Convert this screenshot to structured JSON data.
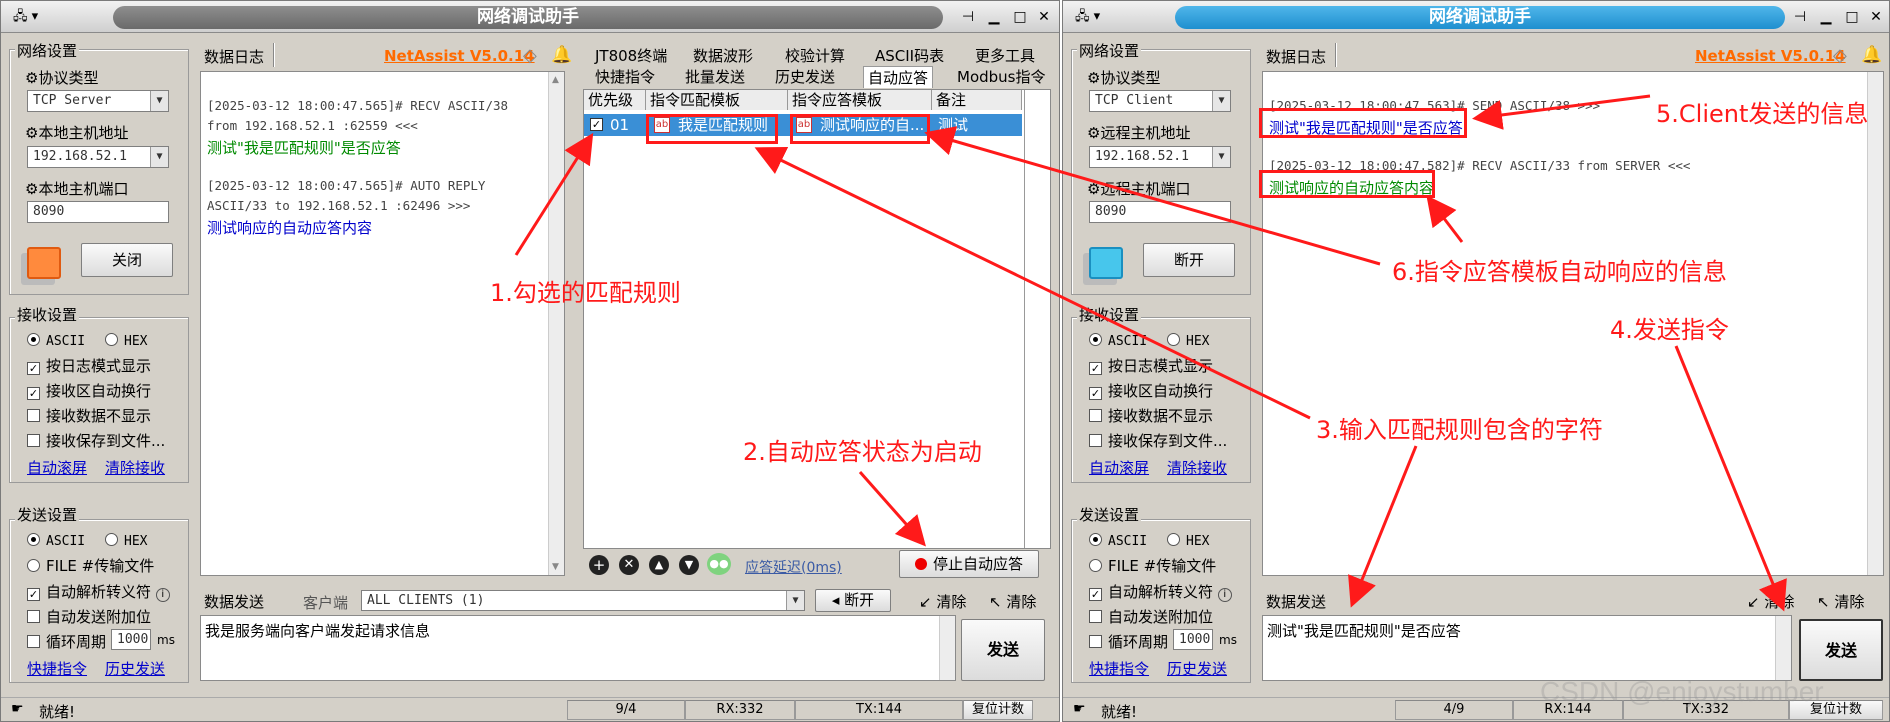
{
  "left": {
    "title": "网络调试助手",
    "brand": "NetAssist V5.0.14",
    "net_group": "网络设置",
    "protocol_label": "协议类型",
    "protocol_value": "TCP Server",
    "host_label": "本地主机地址",
    "host_value": "192.168.52.1",
    "port_label": "本地主机端口",
    "port_value": "8090",
    "connect_btn": "关闭",
    "log_tab": "数据日志",
    "recv_group": "接收设置",
    "recv_ascii": "ASCII",
    "recv_hex": "HEX",
    "recv_opts": [
      "按日志模式显示",
      "接收区自动换行",
      "接收数据不显示",
      "接收保存到文件..."
    ],
    "recv_links": [
      "自动滚屏",
      "清除接收"
    ],
    "send_group": "发送设置",
    "send_ascii": "ASCII",
    "send_hex": "HEX",
    "send_file": "FILE #传输文件",
    "send_opts": [
      "自动解析转义符",
      "自动发送附加位",
      "循环周期"
    ],
    "cycle_value": "1000",
    "cycle_unit": "ms",
    "send_links": [
      "快捷指令",
      "历史发送"
    ],
    "log": {
      "l1": "[2025-03-12 18:00:47.565]# RECV ASCII/38",
      "l2": "from 192.168.52.1 :62559 <<<",
      "l3": "测试\"我是匹配规则\"是否应答",
      "l4": "[2025-03-12 18:00:47.565]# AUTO REPLY",
      "l5": "ASCII/33 to 192.168.52.1 :62496 >>>",
      "l6": "测试响应的自动应答内容"
    },
    "tabs_row1": [
      "JT808终端",
      "数据波形",
      "校验计算",
      "ASCII码表",
      "更多工具"
    ],
    "tabs_row2": [
      "快捷指令",
      "批量发送",
      "历史发送",
      "自动应答",
      "Modbus指令"
    ],
    "grid_headers": [
      "优先级",
      "指令匹配模板",
      "指令应答模板",
      "备注"
    ],
    "grid_row": {
      "priority": "01",
      "match": "我是匹配规则",
      "reply": "测试响应的自...",
      "note": "测试"
    },
    "reply_delay": "应答延迟(0ms)",
    "stop_btn": "停止自动应答",
    "send_tab": "数据发送",
    "client_label": "客户端",
    "client_value": "ALL CLIENTS (1)",
    "disconnect_btn": "断开",
    "clear1": "清除",
    "clear2": "清除",
    "send_text": "我是服务端向客户端发起请求信息",
    "send_btn": "发送",
    "status": "就绪!",
    "sb_count": "9/4",
    "sb_rx": "RX:332",
    "sb_tx": "TX:144",
    "sb_reset": "复位计数"
  },
  "right": {
    "title": "网络调试助手",
    "brand": "NetAssist V5.0.14",
    "net_group": "网络设置",
    "protocol_label": "协议类型",
    "protocol_value": "TCP Client",
    "host_label": "远程主机地址",
    "host_value": "192.168.52.1",
    "port_label": "远程主机端口",
    "port_value": "8090",
    "connect_btn": "断开",
    "log_tab": "数据日志",
    "recv_group": "接收设置",
    "recv_ascii": "ASCII",
    "recv_hex": "HEX",
    "recv_opts": [
      "按日志模式显示",
      "接收区自动换行",
      "接收数据不显示",
      "接收保存到文件..."
    ],
    "recv_links": [
      "自动滚屏",
      "清除接收"
    ],
    "send_group": "发送设置",
    "send_ascii": "ASCII",
    "send_hex": "HEX",
    "send_file": "FILE #传输文件",
    "send_opts": [
      "自动解析转义符",
      "自动发送附加位",
      "循环周期"
    ],
    "cycle_value": "1000",
    "cycle_unit": "ms",
    "send_links": [
      "快捷指令",
      "历史发送"
    ],
    "log": {
      "l1": "[2025-03-12 18:00:47.563]# SEND ASCII/38 >>>",
      "l2": "测试\"我是匹配规则\"是否应答",
      "l3": "[2025-03-12 18:00:47.582]# RECV ASCII/33 from SERVER <<<",
      "l4": "测试响应的自动应答内容"
    },
    "send_tab": "数据发送",
    "clear1": "清除",
    "clear2": "清除",
    "send_text": "测试\"我是匹配规则\"是否应答",
    "send_btn": "发送",
    "status": "就绪!",
    "sb_count": "4/9",
    "sb_rx": "RX:144",
    "sb_tx": "TX:332",
    "sb_reset": "复位计数"
  },
  "annotations": {
    "a1": "1.勾选的匹配规则",
    "a2": "2.自动应答状态为启动",
    "a3": "3.输入匹配规则包含的字符",
    "a4": "4.发送指令",
    "a5": "5.Client发送的信息",
    "a6": "6.指令应答模板自动响应的信息"
  },
  "watermark": "CSDN @enjoystumber",
  "colors": {
    "annotation": "#ff1a1a",
    "brand": "#ff6a00",
    "link": "#0000cc",
    "log_green": "#008a00",
    "title_active": "#1f8fcf"
  }
}
